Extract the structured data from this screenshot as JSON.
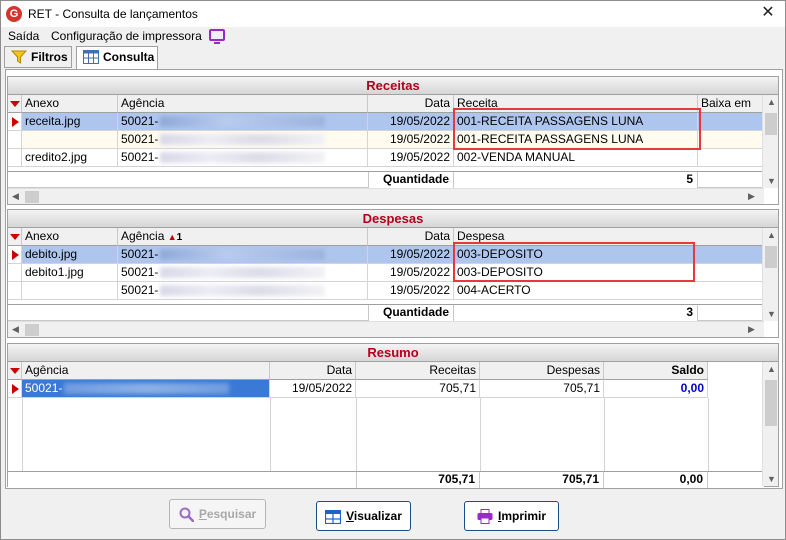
{
  "window": {
    "title": "RET - Consulta de lançamentos",
    "close": "✕"
  },
  "menu": {
    "saida": "Saída",
    "config": "Configuração de impressora"
  },
  "tabs": {
    "filtros": "Filtros",
    "consulta": "Consulta"
  },
  "receitas": {
    "title": "Receitas",
    "columns": {
      "anexo": "Anexo",
      "agencia": "Agência",
      "data": "Data",
      "receita": "Receita",
      "baixa": "Baixa em"
    },
    "rows": [
      {
        "anexo": "receita.jpg",
        "agencia": "50021-",
        "data": "19/05/2022",
        "receita": "001-RECEITA PASSAGENS LUNA"
      },
      {
        "anexo": "",
        "agencia": "50021-",
        "data": "19/05/2022",
        "receita": "001-RECEITA PASSAGENS LUNA"
      },
      {
        "anexo": "credito2.jpg",
        "agencia": "50021-",
        "data": "19/05/2022",
        "receita": "002-VENDA MANUAL"
      }
    ],
    "quantidade_label": "Quantidade",
    "quantidade": "5"
  },
  "despesas": {
    "title": "Despesas",
    "columns": {
      "anexo": "Anexo",
      "agencia": "Agência",
      "sort_num": "1",
      "data": "Data",
      "despesa": "Despesa"
    },
    "rows": [
      {
        "anexo": "debito.jpg",
        "agencia": "50021-",
        "data": "19/05/2022",
        "despesa": "003-DEPOSITO"
      },
      {
        "anexo": "debito1.jpg",
        "agencia": "50021-",
        "data": "19/05/2022",
        "despesa": "003-DEPOSITO"
      },
      {
        "anexo": "",
        "agencia": "50021-",
        "data": "19/05/2022",
        "despesa": "004-ACERTO"
      }
    ],
    "quantidade_label": "Quantidade",
    "quantidade": "3"
  },
  "resumo": {
    "title": "Resumo",
    "columns": {
      "agencia": "Agência",
      "data": "Data",
      "receitas": "Receitas",
      "despesas": "Despesas",
      "saldo": "Saldo"
    },
    "rows": [
      {
        "agencia": "50021-",
        "data": "19/05/2022",
        "receitas": "705,71",
        "despesas": "705,71",
        "saldo": "0,00"
      }
    ],
    "totals": {
      "receitas": "705,71",
      "despesas": "705,71",
      "saldo": "0,00"
    }
  },
  "buttons": {
    "pesquisar_first": "P",
    "pesquisar_rest": "esquisar",
    "visualizar_first": "V",
    "visualizar_rest": "isualizar",
    "imprimir_first": "I",
    "imprimir_rest": "mprimir"
  },
  "colors": {
    "accent_red": "#b2001e",
    "selection": "#aec6ee",
    "highlight_box": "#e8383d",
    "saldo_blue": "#0000cc"
  }
}
